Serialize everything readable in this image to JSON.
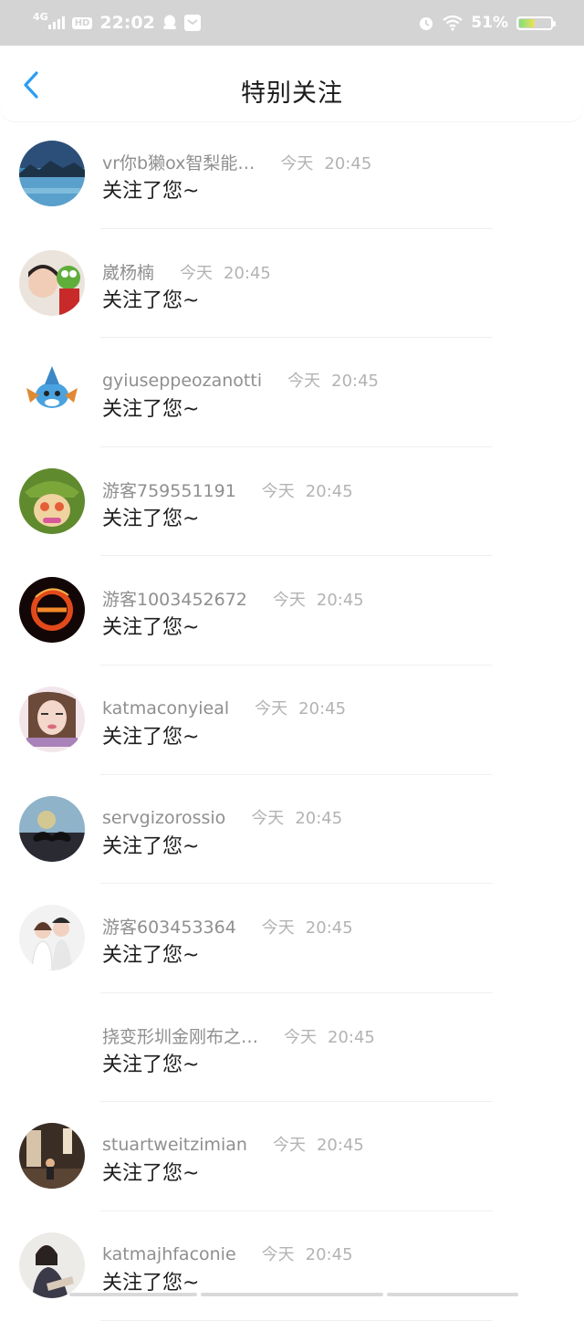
{
  "status_bar": {
    "network": "4G",
    "hd": "HD",
    "time": "22:02",
    "battery_percent": "51%",
    "battery_level": 0.51
  },
  "header": {
    "title": "特别关注",
    "back_icon": "chevron-left-icon"
  },
  "items": [
    {
      "name": "vr你b獭ox智梨能…",
      "time_label": "今天",
      "time": "20:45",
      "message": "关注了您~",
      "avatar": "lake-landscape"
    },
    {
      "name": "崴杨楠",
      "time_label": "今天",
      "time": "20:45",
      "message": "关注了您~",
      "avatar": "girl-with-plush"
    },
    {
      "name": "gyiuseppeozanotti",
      "time_label": "今天",
      "time": "20:45",
      "message": "关注了您~",
      "avatar": "blue-creature"
    },
    {
      "name": "游客759551191",
      "time_label": "今天",
      "time": "20:45",
      "message": "关注了您~",
      "avatar": "green-hat-cartoon"
    },
    {
      "name": "游客1003452672",
      "time_label": "今天",
      "time": "20:45",
      "message": "关注了您~",
      "avatar": "fire-letter"
    },
    {
      "name": "katmaconyieal",
      "time_label": "今天",
      "time": "20:45",
      "message": "关注了您~",
      "avatar": "girl-portrait"
    },
    {
      "name": "servgizorossio",
      "time_label": "今天",
      "time": "20:45",
      "message": "关注了您~",
      "avatar": "mustache"
    },
    {
      "name": "游客603453364",
      "time_label": "今天",
      "time": "20:45",
      "message": "关注了您~",
      "avatar": "couple"
    },
    {
      "name": "挠变形圳金刚布之…",
      "time_label": "今天",
      "time": "20:45",
      "message": "关注了您~",
      "avatar": ""
    },
    {
      "name": "stuartweitzimian",
      "time_label": "今天",
      "time": "20:45",
      "message": "关注了您~",
      "avatar": "cafe-interior"
    },
    {
      "name": "katmajhfaconie",
      "time_label": "今天",
      "time": "20:45",
      "message": "关注了您~",
      "avatar": "girl-sitting"
    }
  ]
}
